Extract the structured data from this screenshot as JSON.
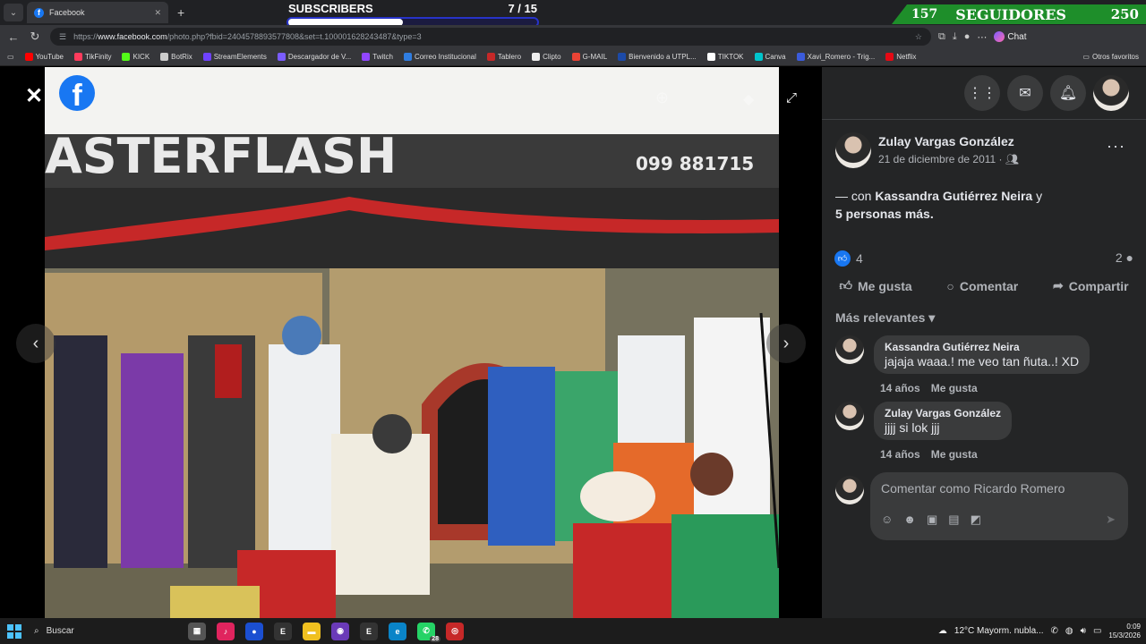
{
  "browser": {
    "tab_title": "Facebook",
    "url_prefix": "https://",
    "url_domain": "www.facebook.com",
    "url_rest": "/photo.php?fbid=2404578893577808&set=t.100001628243487&type=3",
    "chat_label": "Chat",
    "bookmarks": [
      "YouTube",
      "TikFinity",
      "KICK",
      "BotRix",
      "StreamElements",
      "Descargador de V...",
      "Twitch",
      "Correo Institucional",
      "Tablero",
      "Clipto",
      "G-MAIL",
      "Bienvenido a UTPL...",
      "TIKTOK",
      "Canva",
      "Xavi_Romero - Trig...",
      "Netflix"
    ],
    "bookmark_colors": [
      "#ff0000",
      "#ff3b5c",
      "#53fc18",
      "#cccccc",
      "#6f42ff",
      "#7a5cff",
      "#9146ff",
      "#2f7de1",
      "#c62828",
      "#eeeeee",
      "#ea4335",
      "#1c4aa8",
      "#ffffff",
      "#00c4cc",
      "#3b5bdb",
      "#e50914"
    ],
    "other_bookmarks": "Otros favoritos"
  },
  "overlay": {
    "subscribers_label": "SUBSCRIBERS",
    "subscribers_count": "7 / 15",
    "subscribers_progress": 0.46,
    "seguidores_left": "157",
    "seguidores_label": "SEGUIDORES",
    "seguidores_right": "250"
  },
  "photo": {
    "banner_text": "ASTERFLASH",
    "phone_text": "099 881715"
  },
  "post": {
    "author": "Zulay Vargas González",
    "date": "21 de diciembre de 2011",
    "with_prefix": "— con ",
    "with_person": "Kassandra Gutiérrez Neira",
    "with_and": " y",
    "with_others": "5 personas más.",
    "likes_count": "4",
    "comments_count": "2",
    "like_label": "Me gusta",
    "comment_label": "Comentar",
    "share_label": "Compartir",
    "sort_label": "Más relevantes",
    "comments": [
      {
        "name": "Kassandra Gutiérrez Neira",
        "text": "jajaja waaa.! me veo tan ñuta..! XD",
        "time": "14 años",
        "like": "Me gusta"
      },
      {
        "name": "Zulay Vargas González",
        "text": "jjjj si lok jjj",
        "time": "14 años",
        "like": "Me gusta"
      }
    ],
    "compose_placeholder": "Comentar como Ricardo Romero"
  },
  "taskbar": {
    "search_label": "Buscar",
    "weather": "12°C  Mayorm. nubla...",
    "time": "0:09",
    "date": "15/3/2026",
    "whatsapp_badge": "28"
  }
}
